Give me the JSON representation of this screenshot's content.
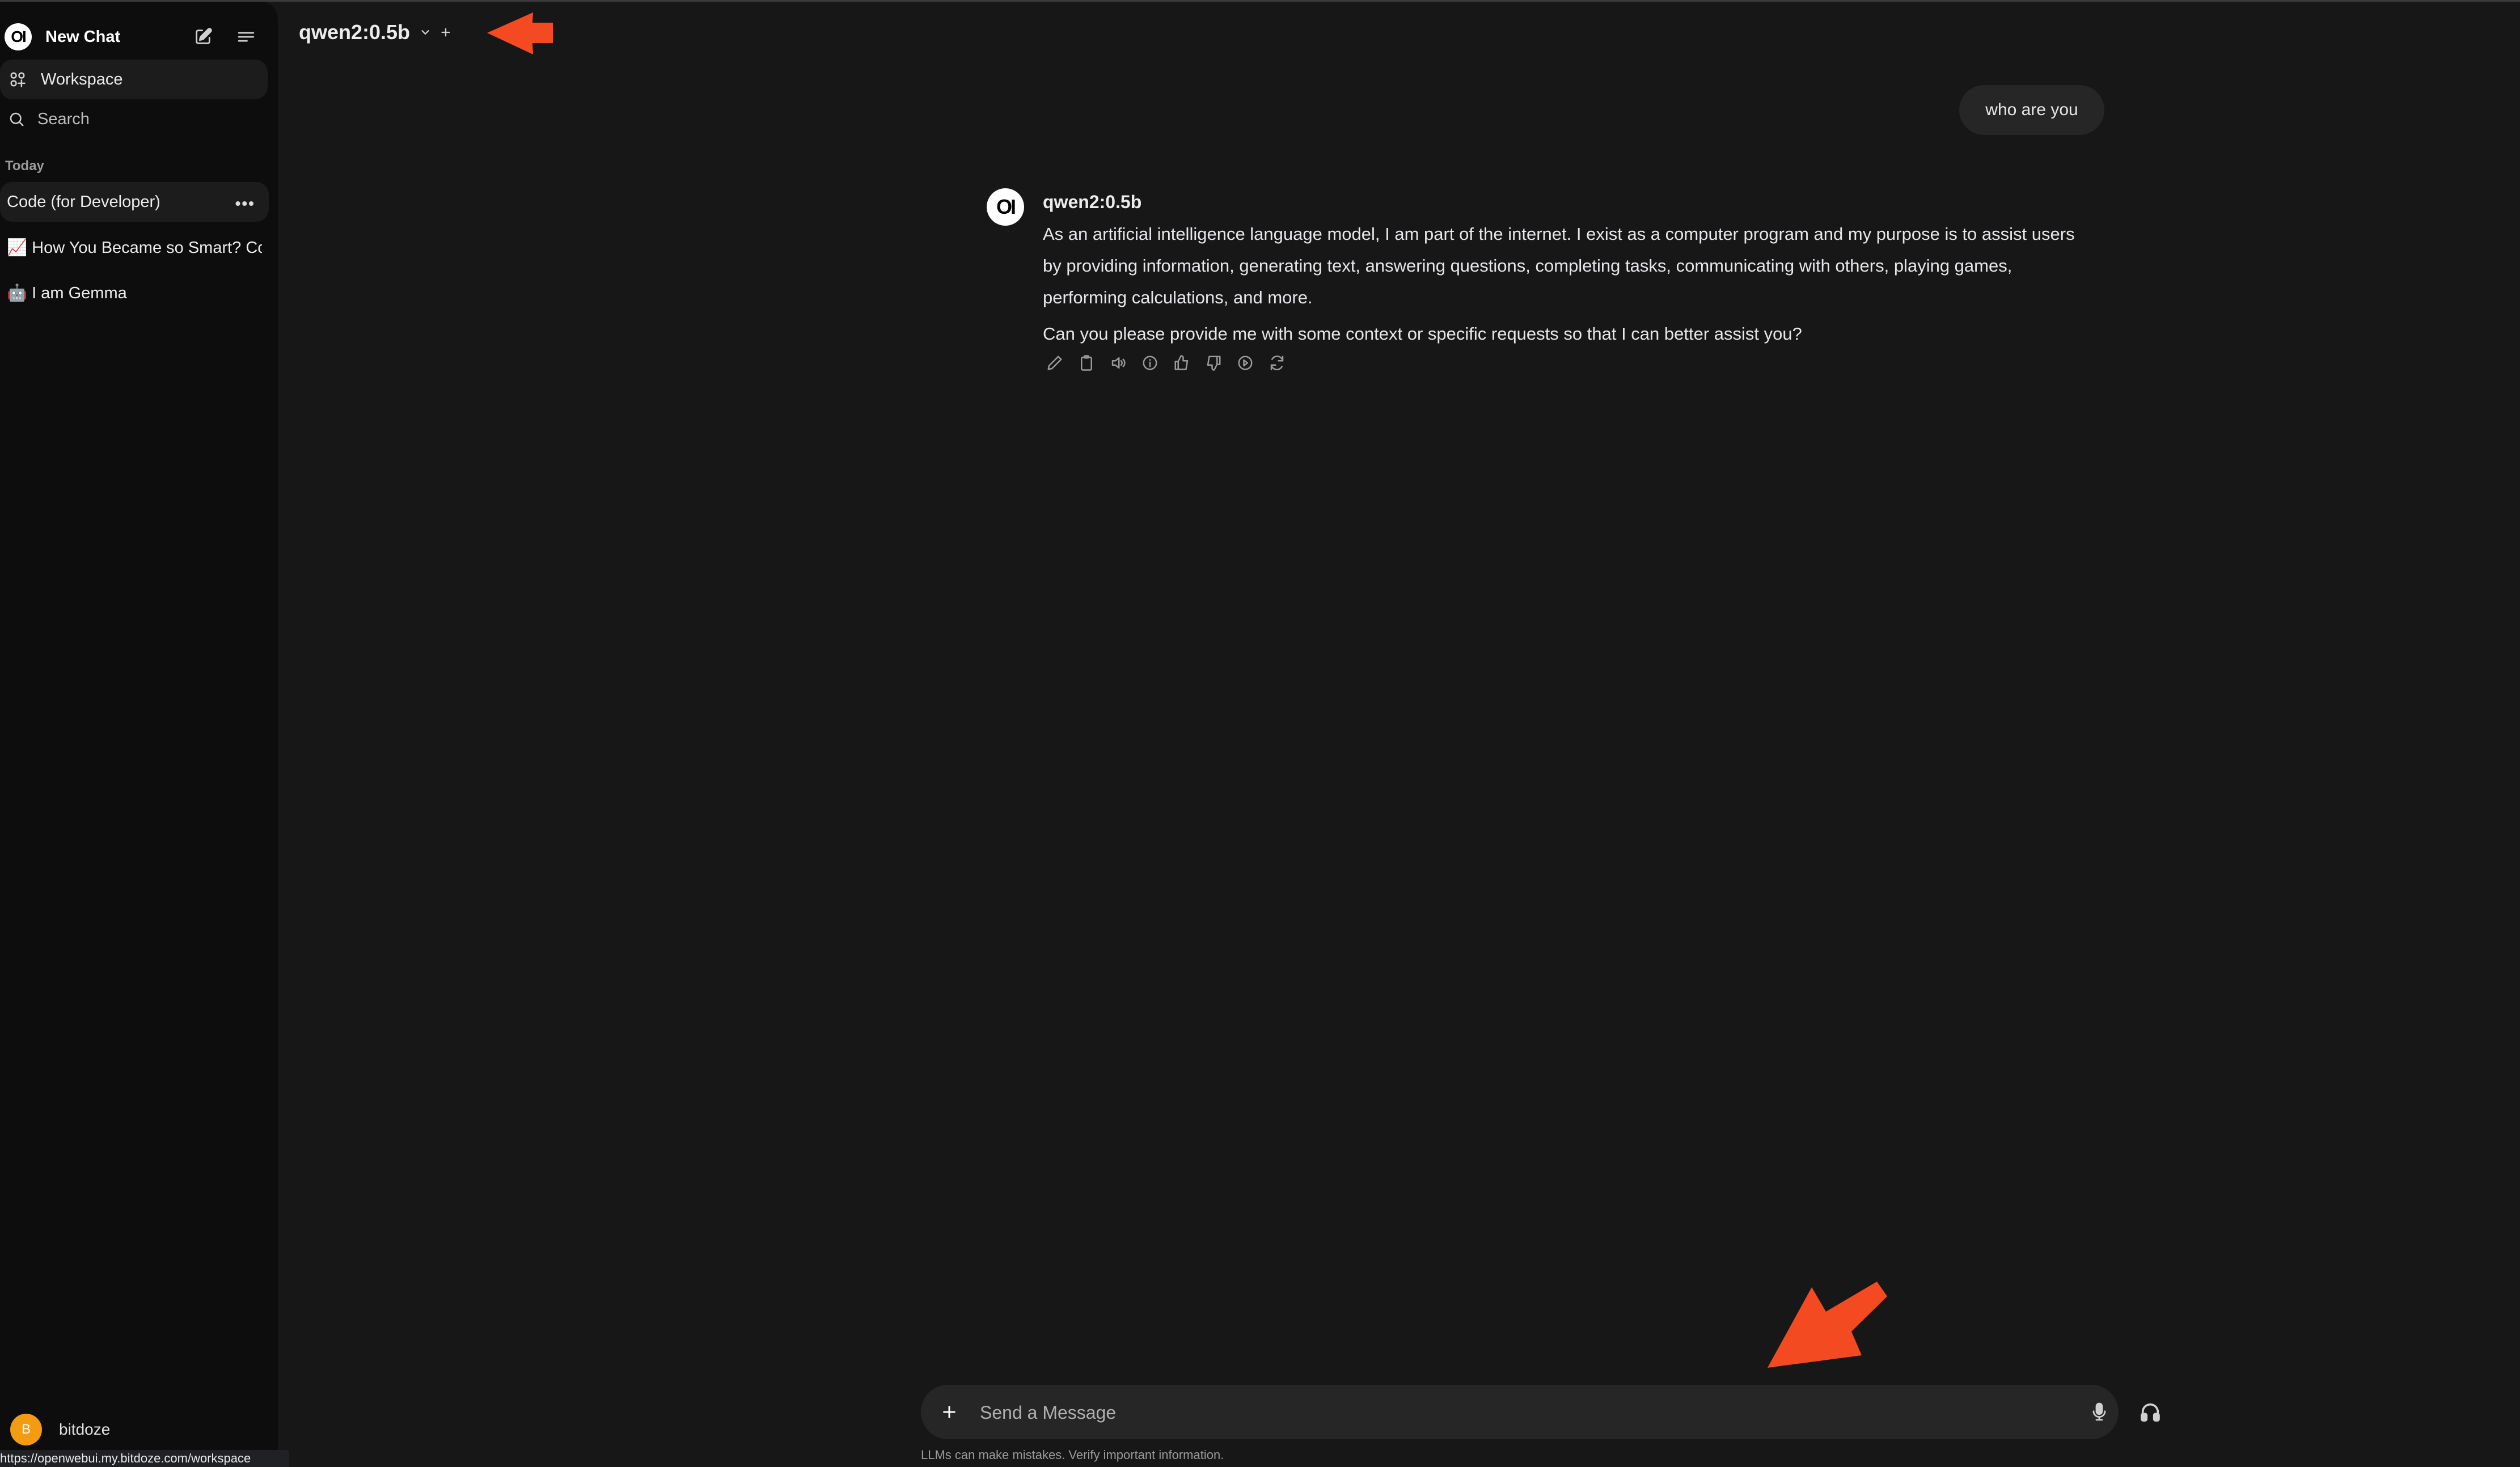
{
  "sidebar": {
    "new_chat_label": "New Chat",
    "logo_text": "OI",
    "nav": [
      {
        "label": "Workspace",
        "icon": "workspace-icon",
        "active": true
      },
      {
        "label": "Search",
        "icon": "search-icon",
        "active": false
      }
    ],
    "section_label": "Today",
    "chats": [
      {
        "label": "Code (for Developer)",
        "active": true
      },
      {
        "label": "📈 How You Became so Smart? Co",
        "active": false
      },
      {
        "label": "🤖 I am Gemma",
        "active": false
      }
    ],
    "user": {
      "initial": "B",
      "name": "bitdoze",
      "avatar_color": "#f39c12"
    },
    "status_url": "https://openwebui.my.bitdoze.com/workspace"
  },
  "header": {
    "model_name": "qwen2:0.5b"
  },
  "conversation": {
    "user_message": "who are you",
    "assistant": {
      "avatar_text": "OI",
      "name": "qwen2:0.5b",
      "paragraphs": [
        "As an artificial intelligence language model, I am part of the internet. I exist as a computer program and my purpose is to assist users by providing information, generating text, answering questions, completing tasks, communicating with others, playing games, performing calculations, and more.",
        "Can you please provide me with some context or specific requests so that I can better assist you?"
      ],
      "actions": [
        "edit",
        "copy",
        "read-aloud",
        "info",
        "good-response",
        "bad-response",
        "continue",
        "regenerate"
      ]
    }
  },
  "composer": {
    "placeholder": "Send a Message",
    "value": "",
    "disclaimer": "LLMs can make mistakes. Verify important information."
  },
  "annotations": {
    "arrow_color": "#f44a22"
  }
}
